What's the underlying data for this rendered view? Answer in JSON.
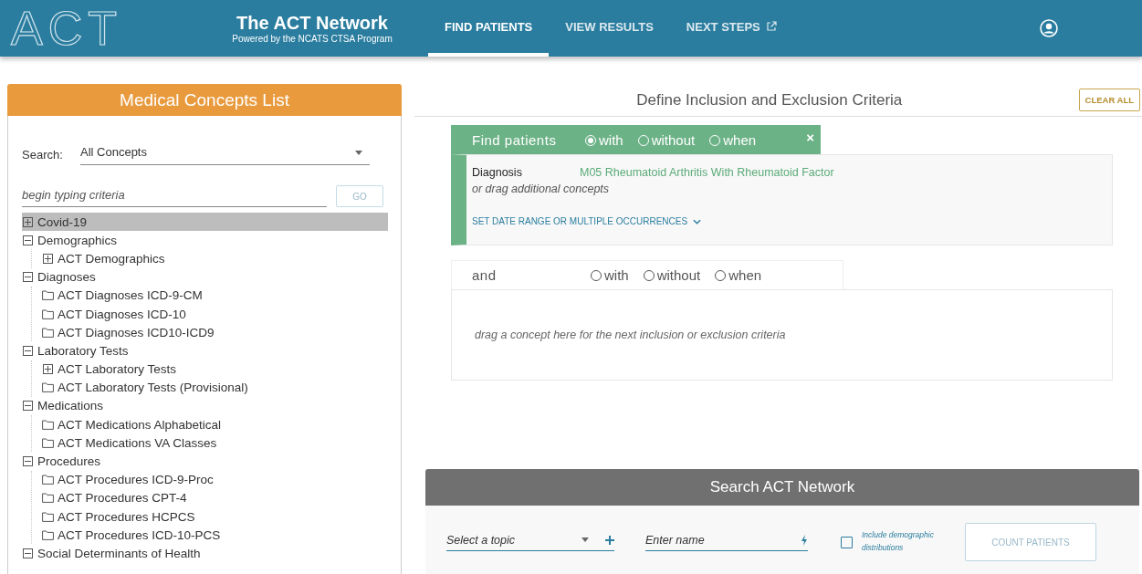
{
  "header": {
    "logo": "ACT",
    "title": "The ACT Network",
    "subtitle": "Powered by the NCATS CTSA Program",
    "tabs": [
      {
        "label": "FIND PATIENTS",
        "selected": true,
        "external": false
      },
      {
        "label": "VIEW RESULTS",
        "selected": false,
        "external": false
      },
      {
        "label": "NEXT STEPS",
        "selected": false,
        "external": true
      }
    ]
  },
  "concepts": {
    "title": "Medical Concepts List",
    "search_label": "Search:",
    "search_value": "All Concepts",
    "query_placeholder": "begin typing criteria",
    "go": "GO",
    "tree": [
      {
        "label": "Covid-19",
        "kind": "group",
        "expanded": false,
        "selected": true
      },
      {
        "label": "Demographics",
        "kind": "group",
        "expanded": true,
        "selected": false,
        "children": [
          {
            "label": "ACT Demographics",
            "kind": "group",
            "expanded": false,
            "selected": false
          }
        ]
      },
      {
        "label": "Diagnoses",
        "kind": "group",
        "expanded": true,
        "selected": false,
        "children": [
          {
            "label": "ACT Diagnoses ICD-9-CM",
            "kind": "folder",
            "selected": false
          },
          {
            "label": "ACT Diagnoses ICD-10",
            "kind": "folder",
            "selected": false
          },
          {
            "label": "ACT Diagnoses ICD10-ICD9",
            "kind": "folder",
            "selected": false
          }
        ]
      },
      {
        "label": "Laboratory Tests",
        "kind": "group",
        "expanded": true,
        "selected": false,
        "children": [
          {
            "label": "ACT Laboratory Tests",
            "kind": "group",
            "expanded": false,
            "selected": false
          },
          {
            "label": "ACT Laboratory Tests (Provisional)",
            "kind": "folder",
            "selected": false
          }
        ]
      },
      {
        "label": "Medications",
        "kind": "group",
        "expanded": true,
        "selected": false,
        "children": [
          {
            "label": "ACT Medications Alphabetical",
            "kind": "folder",
            "selected": false
          },
          {
            "label": "ACT Medications VA Classes",
            "kind": "folder",
            "selected": false
          }
        ]
      },
      {
        "label": "Procedures",
        "kind": "group",
        "expanded": true,
        "selected": false,
        "children": [
          {
            "label": "ACT Procedures ICD-9-Proc",
            "kind": "folder",
            "selected": false
          },
          {
            "label": "ACT Procedures CPT-4",
            "kind": "folder",
            "selected": false
          },
          {
            "label": "ACT Procedures HCPCS",
            "kind": "folder",
            "selected": false
          },
          {
            "label": "ACT Procedures ICD-10-PCS",
            "kind": "folder",
            "selected": false
          }
        ]
      },
      {
        "label": "Social Determinants of Health",
        "kind": "group",
        "expanded": true,
        "selected": false
      }
    ]
  },
  "criteria": {
    "title": "Define Inclusion and Exclusion Criteria",
    "clear_all": "CLEAR ALL",
    "groups": [
      {
        "label": "Find patients",
        "active": true,
        "close": "×",
        "options": [
          {
            "label": "with",
            "selected": true
          },
          {
            "label": "without",
            "selected": false
          },
          {
            "label": "when",
            "selected": false
          }
        ],
        "concepts": [
          {
            "type": "Diagnosis",
            "name": "M05 Rheumatoid Arthritis With Rheumatoid Factor"
          }
        ],
        "hint": "or drag additional concepts",
        "link": "SET DATE RANGE OR MULTIPLE OCCURRENCES"
      },
      {
        "label": "and",
        "active": false,
        "options": [
          {
            "label": "with",
            "selected": false
          },
          {
            "label": "without",
            "selected": false
          },
          {
            "label": "when",
            "selected": false
          }
        ],
        "hint": "drag a concept here for the next inclusion or exclusion criteria"
      }
    ]
  },
  "search": {
    "title": "Search ACT Network",
    "topic_placeholder": "Select a topic",
    "name_placeholder": "Enter name",
    "demographics": {
      "label": "Include demographic distributions",
      "checked": false
    },
    "button": "COUNT PATIENTS"
  }
}
